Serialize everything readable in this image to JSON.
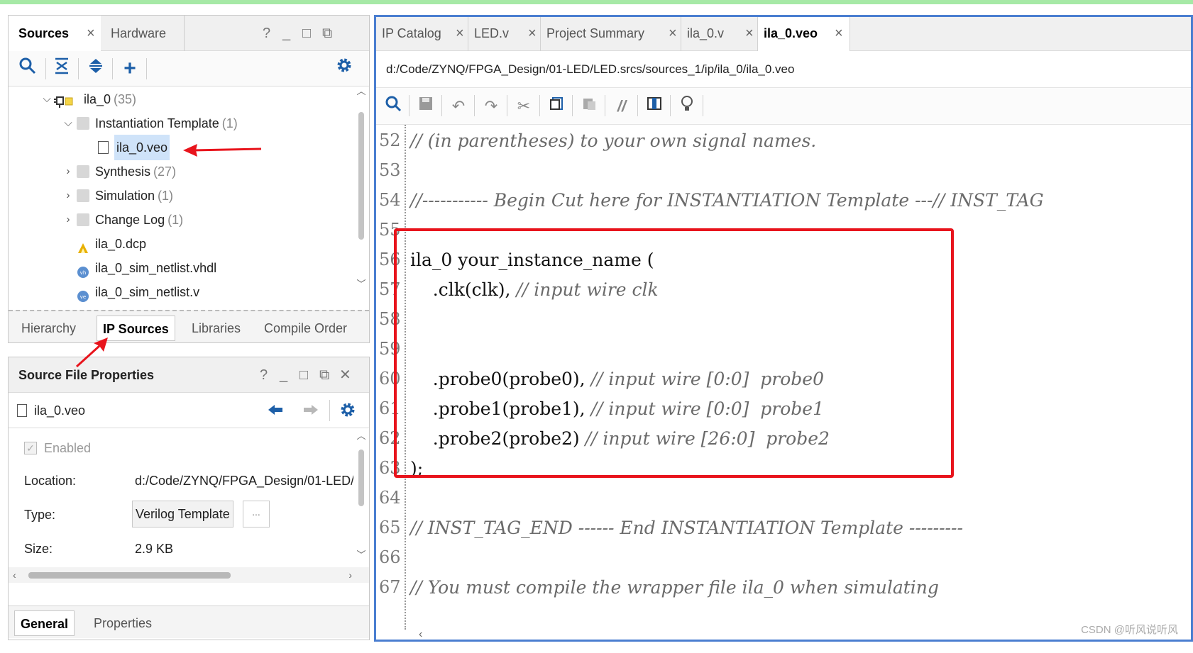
{
  "sources_panel": {
    "tabs": [
      {
        "label": "Sources"
      },
      {
        "label": "Hardware"
      }
    ],
    "window_controls": [
      "?",
      "_",
      "□",
      "⧉"
    ],
    "tree": [
      {
        "label": "ila_0",
        "count": "(35)"
      },
      {
        "label": "Instantiation Template",
        "count": "(1)"
      },
      {
        "label": "ila_0.veo",
        "count": ""
      },
      {
        "label": "Synthesis",
        "count": "(27)"
      },
      {
        "label": "Simulation",
        "count": "(1)"
      },
      {
        "label": "Change Log",
        "count": "(1)"
      },
      {
        "label": "ila_0.dcp",
        "count": ""
      },
      {
        "label": "ila_0_sim_netlist.vhdl",
        "count": ""
      },
      {
        "label": "ila_0_sim_netlist.v",
        "count": ""
      }
    ],
    "bottom_tabs": [
      {
        "label": "Hierarchy"
      },
      {
        "label": "IP Sources"
      },
      {
        "label": "Libraries"
      },
      {
        "label": "Compile Order"
      }
    ]
  },
  "properties_panel": {
    "title": "Source File Properties",
    "window_controls": [
      "?",
      "_",
      "□",
      "⧉",
      "✕"
    ],
    "file_name": "ila_0.veo",
    "enabled_label": "Enabled",
    "location_label": "Location:",
    "location_value": "d:/Code/ZYNQ/FPGA_Design/01-LED/",
    "type_label": "Type:",
    "type_value": "Verilog Template",
    "more_button": "...",
    "size_label": "Size:",
    "size_value": "2.9 KB",
    "bottom_tabs": [
      {
        "label": "General"
      },
      {
        "label": "Properties"
      }
    ]
  },
  "editor": {
    "tabs": [
      {
        "label": "IP Catalog"
      },
      {
        "label": "LED.v"
      },
      {
        "label": "Project Summary"
      },
      {
        "label": "ila_0.v"
      },
      {
        "label": "ila_0.veo"
      }
    ],
    "path": "d:/Code/ZYNQ/FPGA_Design/01-LED/LED.srcs/sources_1/ip/ila_0/ila_0.veo",
    "lines": [
      {
        "num": "52",
        "code": "",
        "comment": "// (in parentheses) to your own signal names."
      },
      {
        "num": "53",
        "code": "",
        "comment": ""
      },
      {
        "num": "54",
        "code": "",
        "comment": "//----------- Begin Cut here for INSTANTIATION Template ---// INST_TAG"
      },
      {
        "num": "55",
        "code": "",
        "comment": ""
      },
      {
        "num": "56",
        "code": "ila_0 your_instance_name (",
        "comment": ""
      },
      {
        "num": "57",
        "code": "    .clk(clk), ",
        "comment": "// input wire clk"
      },
      {
        "num": "58",
        "code": "",
        "comment": ""
      },
      {
        "num": "59",
        "code": "",
        "comment": ""
      },
      {
        "num": "60",
        "code": "    .probe0(probe0), ",
        "comment": "// input wire [0:0]  probe0"
      },
      {
        "num": "61",
        "code": "    .probe1(probe1), ",
        "comment": "// input wire [0:0]  probe1"
      },
      {
        "num": "62",
        "code": "    .probe2(probe2) ",
        "comment": "// input wire [26:0]  probe2"
      },
      {
        "num": "63",
        "code": ");",
        "comment": ""
      },
      {
        "num": "64",
        "code": "",
        "comment": ""
      },
      {
        "num": "65",
        "code": "",
        "comment": "// INST_TAG_END ------ End INSTANTIATION Template ---------"
      },
      {
        "num": "66",
        "code": "",
        "comment": ""
      },
      {
        "num": "67",
        "code": "",
        "comment": "// You must compile the wrapper file ila_0 when simulating"
      }
    ]
  },
  "watermark": "CSDN @听风说听风",
  "colors": {
    "accent": "#1d5fa8",
    "annotation": "#e8141c",
    "selection": "#cfe3f9",
    "editor_border": "#4a7ed0"
  }
}
